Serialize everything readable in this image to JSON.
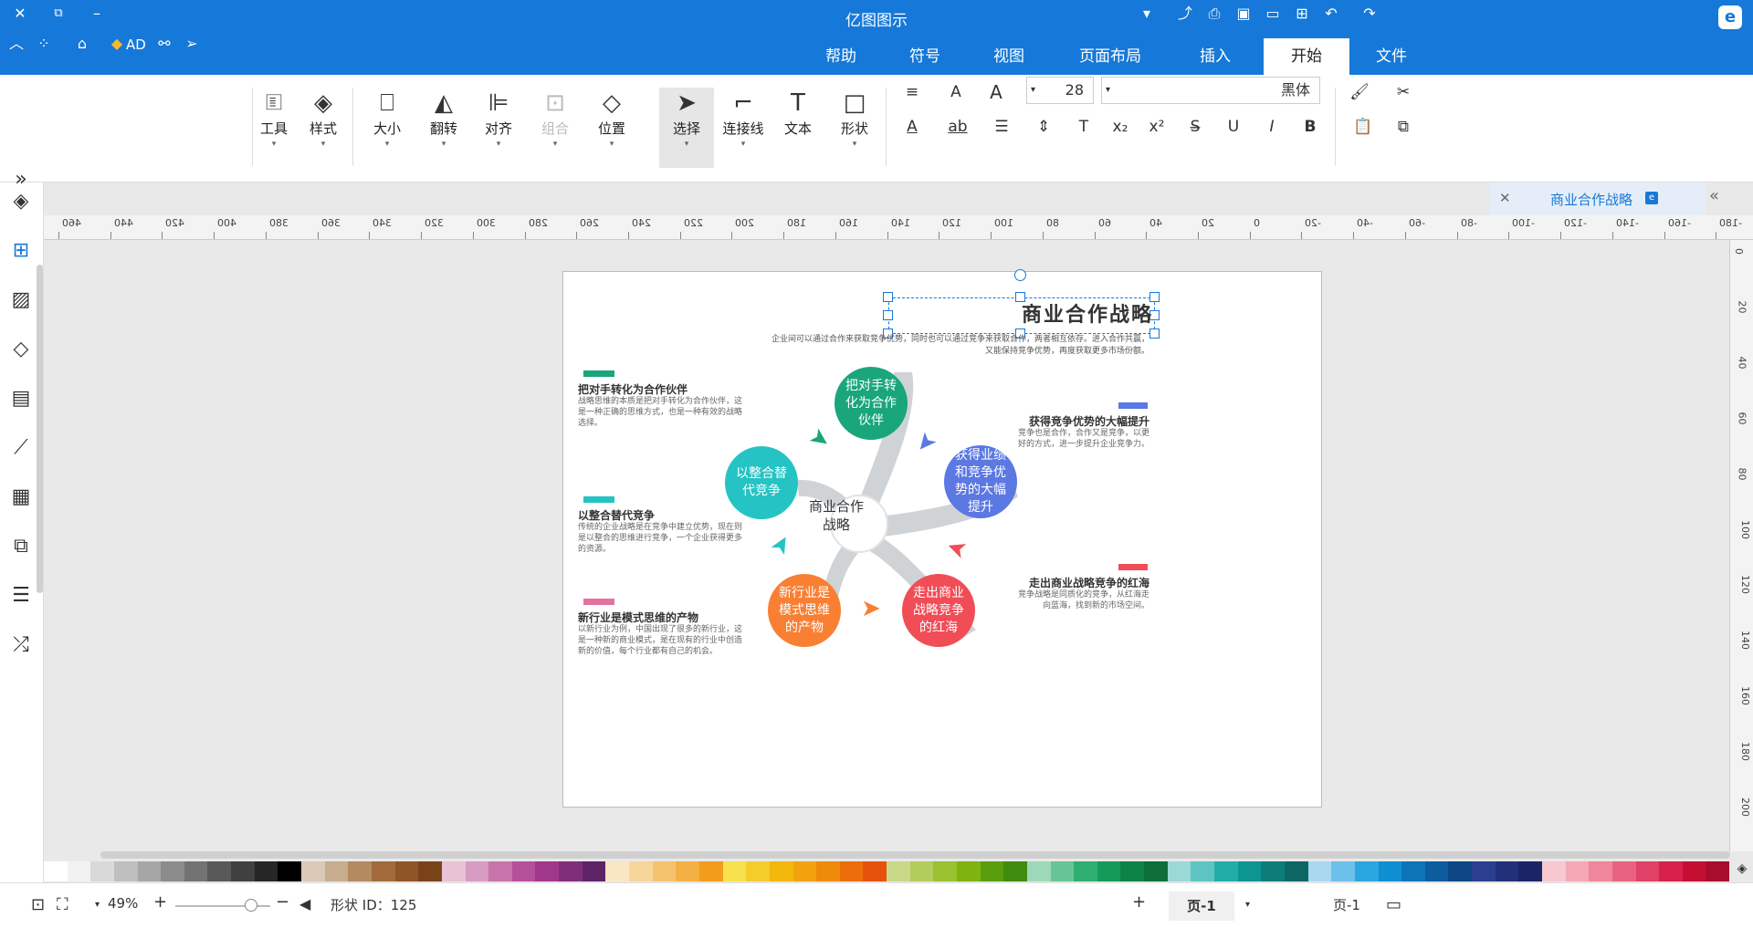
{
  "app": {
    "title": "亿图图示"
  },
  "titlebar": {
    "icons": [
      "close-icon",
      "restore-icon",
      "minimize-icon",
      "dropdown-icon",
      "share-icon",
      "print-icon",
      "save-icon",
      "folder-icon",
      "new-icon",
      "undo-icon",
      "redo-icon",
      "collapse-icon",
      "apps-icon",
      "theme-icon",
      "premium-icon",
      "mindmap-icon",
      "send-icon"
    ],
    "ad_label": "AD"
  },
  "tabs": [
    {
      "label": "帮助"
    },
    {
      "label": "符号"
    },
    {
      "label": "视图"
    },
    {
      "label": "页面布局"
    },
    {
      "label": "插入"
    },
    {
      "label": "开始",
      "active": true
    },
    {
      "label": "文件"
    }
  ],
  "ribbon": {
    "tools": [
      {
        "label": "工具",
        "icon": "tools-icon"
      },
      {
        "label": "样式",
        "icon": "style-icon"
      },
      {
        "label": "大小",
        "icon": "size-icon"
      },
      {
        "label": "翻转",
        "icon": "flip-icon"
      },
      {
        "label": "对齐",
        "icon": "align-icon"
      },
      {
        "label": "组合",
        "icon": "group-icon",
        "disabled": true
      },
      {
        "label": "位置",
        "icon": "position-icon"
      },
      {
        "label": "选择",
        "icon": "select-icon",
        "selected": true
      },
      {
        "label": "连接线",
        "icon": "connector-icon"
      },
      {
        "label": "文本",
        "icon": "text-icon"
      },
      {
        "label": "形状",
        "icon": "shape-icon"
      }
    ],
    "font_size": "28",
    "font_name": "黑体",
    "format_buttons": [
      "bold-icon",
      "italic-icon",
      "underline-icon",
      "strikethrough-icon",
      "superscript-icon",
      "subscript-icon",
      "font-color-icon",
      "highlight-icon",
      "line-spacing-icon",
      "bullets-icon",
      "font-grow-icon",
      "font-shrink-icon",
      "align-text-icon",
      "cut-icon",
      "copy-icon",
      "paste-icon",
      "format-painter-icon"
    ]
  },
  "document_tab": {
    "label": "商业合作战略"
  },
  "ruler": {
    "h_labels": [
      "460",
      "440",
      "420",
      "400",
      "380",
      "360",
      "340",
      "320",
      "300",
      "280",
      "260",
      "240",
      "220",
      "200",
      "180",
      "160",
      "140",
      "120",
      "100",
      "80",
      "60",
      "40",
      "20",
      "0",
      "-20",
      "-40",
      "-60",
      "-80",
      "-100",
      "-120",
      "-140",
      "-160",
      "-180"
    ],
    "v_labels": [
      "0",
      "20",
      "40",
      "60",
      "80",
      "100",
      "120",
      "140",
      "160",
      "180",
      "200"
    ]
  },
  "diagram": {
    "title": "商业合作战略",
    "intro": "企业间可以通过合作来获取竞争优势，同时也可以通过竞争来获取合作，两者相互依存。进入合作共赢，又能保持竞争优势，再度获取更多市场份额。",
    "center": "商业合作战略",
    "nodes": [
      {
        "label": "把对手转化为合作伙伴",
        "color": "#19a67a"
      },
      {
        "label": "获得业绩和竞争优势的大幅提升",
        "color": "#5b78e3"
      },
      {
        "label": "走出商业战略竞争的红海",
        "color": "#f04d56"
      },
      {
        "label": "新行业是模式思维的产物",
        "color": "#f97f33"
      },
      {
        "label": "以整合替代竞争",
        "color": "#25c3c3"
      }
    ],
    "items": [
      {
        "title": "把对手转化为合作伙伴",
        "text": "战略思维的本质是把对手转化为合作伙伴，这是一种正确的思维方式，也是一种有效的战略选择。",
        "color": "#19a67a"
      },
      {
        "title": "获得竞争优势的大幅提升",
        "text": "竞争也是合作，合作又是竞争，以更好的方式，进一步提升企业竞争力。",
        "color": "#5b78e3"
      },
      {
        "title": "以整合替代竞争",
        "text": "传统的企业战略是在竞争中建立优势，现在则是以整合的思维进行竞争，一个企业获得更多的资源。",
        "color": "#25c3c3"
      },
      {
        "title": "走出商业战略竞争的红海",
        "text": "竞争战略是同质化的竞争，从红海走向蓝海，找到新的市场空间。",
        "color": "#f04d56"
      },
      {
        "title": "新行业是模式思维的产物",
        "text": "以新行业为例，中国出现了很多的新行业，这是一种新的商业模式，是在现有的行业中创造新的价值，每个行业都有自己的机会。",
        "color": "#e472a0"
      }
    ]
  },
  "palette": [
    "#ffffff",
    "#f2f2f2",
    "#d9d9d9",
    "#bfbfbf",
    "#a6a6a6",
    "#8c8c8c",
    "#737373",
    "#595959",
    "#404040",
    "#262626",
    "#000000",
    "#d9c9b6",
    "#c7ad8e",
    "#b48b5e",
    "#a36b3c",
    "#8f5527",
    "#7a4218",
    "#e9c2d6",
    "#d89bc1",
    "#c774aa",
    "#b4519a",
    "#a0378a",
    "#7f2f7a",
    "#5e2467",
    "#f9e7c4",
    "#f7d69a",
    "#f5c36e",
    "#f4b043",
    "#f39c1b",
    "#f7e14d",
    "#f4cd2b",
    "#f2b80b",
    "#f2a30b",
    "#f08a0b",
    "#ed6d0b",
    "#e6520b",
    "#c9d98a",
    "#b3cd5c",
    "#9ac12f",
    "#7fb30d",
    "#5a9e0d",
    "#3e8c10",
    "#9dd9b8",
    "#67c494",
    "#2fae72",
    "#159a5a",
    "#0d8348",
    "#0d6e3a",
    "#9bd9d6",
    "#5dc4c1",
    "#22ada9",
    "#0d9591",
    "#0d7d7a",
    "#0d6664",
    "#a8d8f0",
    "#6cc0ea",
    "#2aa6e0",
    "#0d8fd2",
    "#0d74b8",
    "#0d5c9e",
    "#0d4683",
    "#2a3f8f",
    "#22307a",
    "#1a2566",
    "#f7c8d0",
    "#f4a8b6",
    "#ef869b",
    "#e86380",
    "#e04166",
    "#d8204d",
    "#c40f32",
    "#a80d2b"
  ],
  "status": {
    "page_tab": "页-1",
    "page_selector": "页-1",
    "shape_id": "形状 ID：125",
    "zoom": "49%"
  }
}
